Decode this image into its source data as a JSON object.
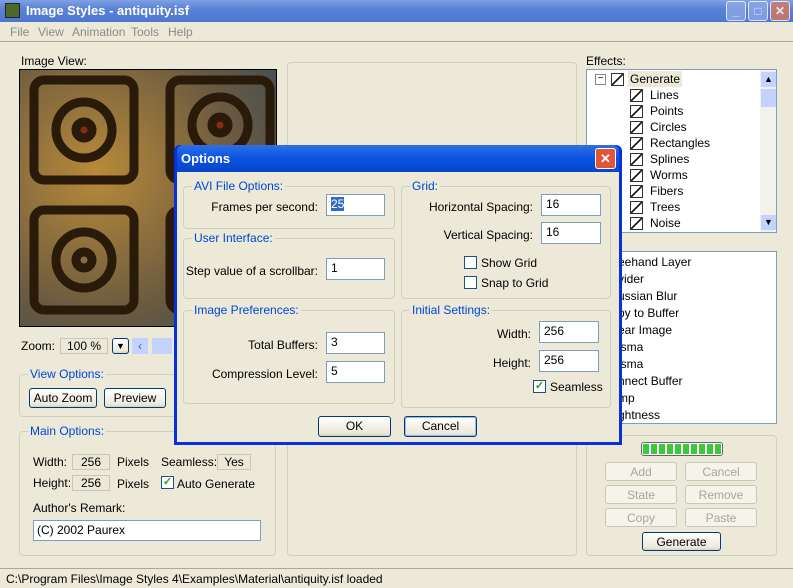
{
  "window": {
    "title": "Image Styles - antiquity.isf"
  },
  "menu": [
    "File",
    "View",
    "Animation",
    "Tools",
    "Help"
  ],
  "image_view": {
    "label": "Image View:"
  },
  "zoom": {
    "label": "Zoom:",
    "value": "100 %"
  },
  "view_options": {
    "label": "View Options:",
    "auto_zoom": "Auto Zoom",
    "preview": "Preview"
  },
  "main_options": {
    "label": "Main Options:",
    "width_label": "Width:",
    "width": "256",
    "height_label": "Height:",
    "height": "256",
    "pixels": "Pixels",
    "seamless_label": "Seamless:",
    "seamless": "Yes",
    "auto_generate": "Auto Generate",
    "auto_generate_checked": true,
    "author_label": "Author's Remark:",
    "author": "(C) 2002 Paurex"
  },
  "effects": {
    "label": "Effects:",
    "root": "Generate",
    "items": [
      "Lines",
      "Points",
      "Circles",
      "Rectangles",
      "Splines",
      "Worms",
      "Fibers",
      "Trees",
      "Noise"
    ]
  },
  "layers": [
    "eehand Layer",
    "vider",
    "ussian Blur",
    "py to Buffer",
    "ear Image",
    "isma",
    "isma",
    "nnect Buffer",
    "mp",
    "ghtness"
  ],
  "progress": {
    "value": 1.0,
    "color": "#3cc83c"
  },
  "actions": {
    "add": "Add",
    "cancel": "Cancel",
    "state": "State",
    "remove": "Remove",
    "copy": "Copy",
    "paste": "Paste",
    "generate": "Generate"
  },
  "status": "C:\\Program Files\\Image Styles 4\\Examples\\Material\\antiquity.isf loaded",
  "dialog": {
    "title": "Options",
    "avi": {
      "label": "AVI File Options:",
      "fps_label": "Frames per second:",
      "fps": "25"
    },
    "ui": {
      "label": "User Interface:",
      "step_label": "Step value of a scrollbar:",
      "step": "1"
    },
    "prefs": {
      "label": "Image Preferences:",
      "buffers_label": "Total Buffers:",
      "buffers": "3",
      "compression_label": "Compression Level:",
      "compression": "5"
    },
    "grid": {
      "label": "Grid:",
      "h_label": "Horizontal Spacing:",
      "h": "16",
      "v_label": "Vertical Spacing:",
      "v": "16",
      "show": "Show Grid",
      "snap": "Snap to Grid"
    },
    "initial": {
      "label": "Initial Settings:",
      "w_label": "Width:",
      "w": "256",
      "h_label": "Height:",
      "h": "256",
      "seamless": "Seamless"
    },
    "ok": "OK",
    "cancel": "Cancel"
  }
}
